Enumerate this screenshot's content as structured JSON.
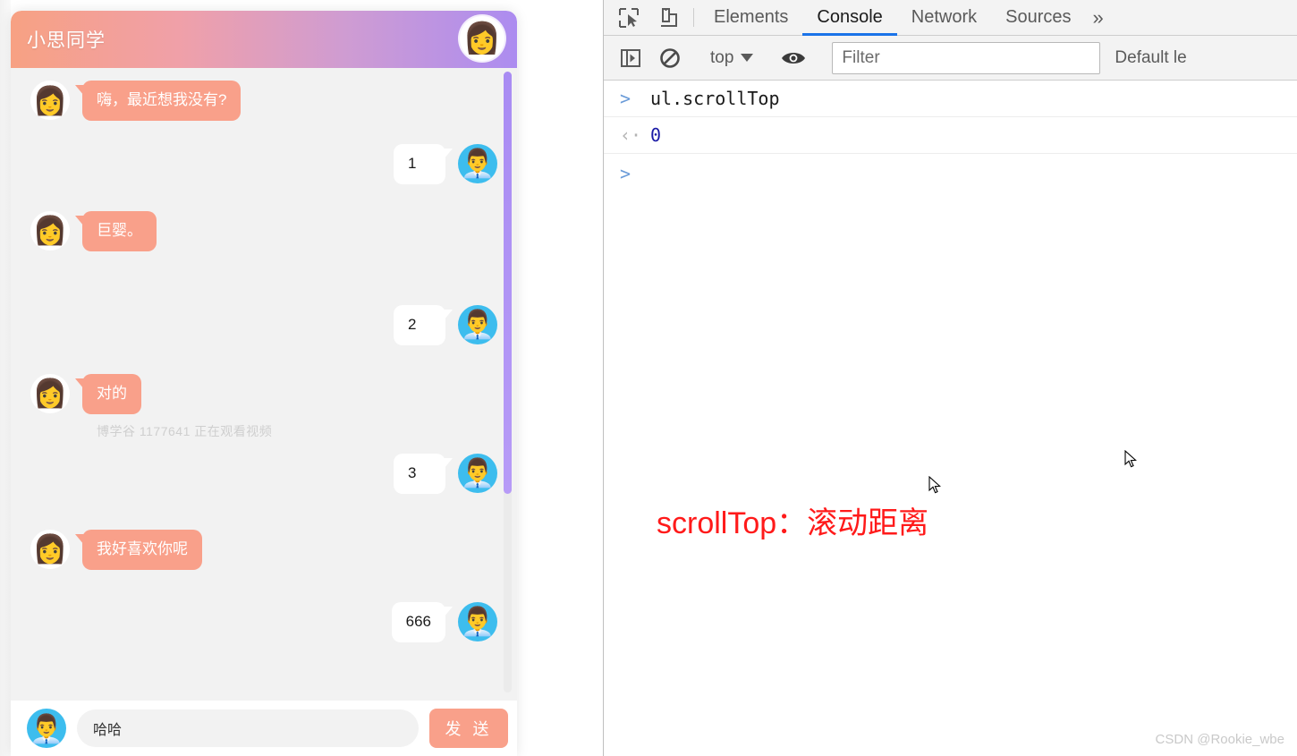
{
  "chat": {
    "title": "小思同学",
    "header_avatar_icon": "woman-avatar-icon",
    "messages": [
      {
        "side": "left",
        "text": "嗨，最近想我没有?",
        "avatar": "woman-avatar-icon"
      },
      {
        "side": "right",
        "text": "1",
        "avatar": "man-avatar-icon"
      },
      {
        "side": "left",
        "text": "巨婴。",
        "avatar": "woman-avatar-icon"
      },
      {
        "side": "right",
        "text": "2",
        "avatar": "man-avatar-icon"
      },
      {
        "side": "left",
        "text": "对的",
        "avatar": "woman-avatar-icon"
      },
      {
        "side": "right",
        "text": "3",
        "avatar": "man-avatar-icon"
      },
      {
        "side": "left",
        "text": "我好喜欢你呢",
        "avatar": "woman-avatar-icon"
      },
      {
        "side": "right",
        "text": "666",
        "avatar": "man-avatar-icon"
      }
    ],
    "watermark": "博学谷 1177641 正在观看视频",
    "input": {
      "value": "哈哈",
      "placeholder": ""
    },
    "send_label": "发 送",
    "input_avatar_icon": "man-avatar-icon",
    "colors": {
      "header_start": "#f7a183",
      "header_end": "#ac8cf0",
      "bubble_her": "#f9a08a",
      "bubble_him": "#ffffff",
      "scrollbar_thumb": "#a98cf3",
      "avatar_him_bg": "#3dbdee"
    }
  },
  "devtools": {
    "icons": {
      "inspect": "inspect-element-icon",
      "device": "device-toolbar-icon",
      "sidebar": "console-sidebar-icon",
      "clear": "clear-console-icon",
      "eye": "live-expression-eye-icon",
      "overflow": "more-tabs-chevron-icon",
      "dropdown": "chevron-down-icon"
    },
    "tabs": [
      {
        "label": "Elements",
        "active": false
      },
      {
        "label": "Console",
        "active": true
      },
      {
        "label": "Network",
        "active": false
      },
      {
        "label": "Sources",
        "active": false
      }
    ],
    "overflow_label": "»",
    "console_toolbar": {
      "context": "top",
      "filter_placeholder": "Filter",
      "filter_value": "",
      "levels_label": "Default le"
    },
    "console": {
      "input_prompt": ">",
      "input_expression": "ul.scrollTop",
      "result_prompt": "‹·",
      "result_value": "0",
      "next_prompt": ">"
    },
    "annotation": "scrollTop：滚动距离",
    "annotation_color": "#ff1a1a",
    "watermark": "CSDN @Rookie_wbe"
  }
}
